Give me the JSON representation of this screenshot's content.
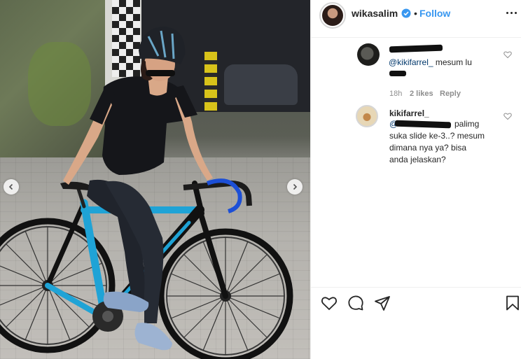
{
  "header": {
    "username": "wikasalim",
    "separator": "•",
    "follow_label": "Follow"
  },
  "comments": [
    {
      "author": "",
      "mention": "@kikifarrel_",
      "text": " mesum lu",
      "time": "18h",
      "likes": "2 likes",
      "reply_label": "Reply"
    },
    {
      "author": "kikifarrel_",
      "line1_tail": "palimg",
      "line1_prefix": "@",
      "line2": "suka slide ke-3..? mesum",
      "line3": "dimana nya ya? bisa",
      "line4": "anda jelaskan?"
    }
  ],
  "icons": {
    "verified": "verified-badge-icon",
    "more": "more-options-icon",
    "like": "heart-icon",
    "comment": "comment-bubble-icon",
    "share": "paper-plane-icon",
    "save": "bookmark-icon",
    "prev": "chevron-left-icon",
    "next": "chevron-right-icon"
  },
  "colors": {
    "link": "#3897f0",
    "mention": "#00376b",
    "meta": "#8e8e8e",
    "text": "#262626",
    "bike_frame": "#1fa3d6"
  }
}
